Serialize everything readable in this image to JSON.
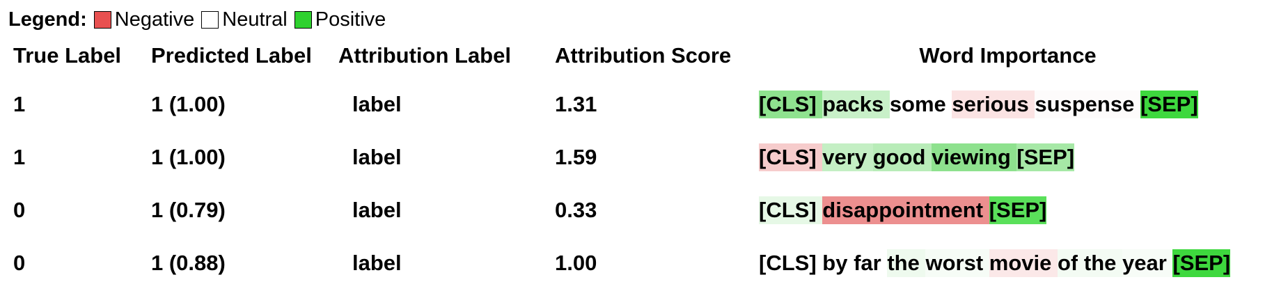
{
  "legend": {
    "title": "Legend:",
    "items": [
      {
        "label": "Negative",
        "color": "#e85050"
      },
      {
        "label": "Neutral",
        "color": "#ffffff"
      },
      {
        "label": "Positive",
        "color": "#2fd12f"
      }
    ]
  },
  "table": {
    "headers": [
      "True Label",
      "Predicted Label",
      "Attribution Label",
      "Attribution Score",
      "Word Importance"
    ],
    "rows": [
      {
        "true_label": "1",
        "predicted_label": "1 (1.00)",
        "attribution_label": "label",
        "attribution_score": "1.31",
        "tokens": [
          {
            "text": "[CLS]",
            "color": "#8fe28f"
          },
          {
            "text": "packs",
            "color": "#c8f0c8"
          },
          {
            "text": "some",
            "color": "#ffffff"
          },
          {
            "text": "serious",
            "color": "#fbe3e3"
          },
          {
            "text": "suspense",
            "color": "#fdfbfb"
          },
          {
            "text": "[SEP]",
            "color": "#3ed83e"
          }
        ]
      },
      {
        "true_label": "1",
        "predicted_label": "1 (1.00)",
        "attribution_label": "label",
        "attribution_score": "1.59",
        "tokens": [
          {
            "text": "[CLS]",
            "color": "#f6cccc"
          },
          {
            "text": "very",
            "color": "#c4efc4"
          },
          {
            "text": "good",
            "color": "#b8ecb8"
          },
          {
            "text": "viewing",
            "color": "#8ee18e"
          },
          {
            "text": "[SEP]",
            "color": "#a6e8a6"
          }
        ]
      },
      {
        "true_label": "0",
        "predicted_label": "1 (0.79)",
        "attribution_label": "label",
        "attribution_score": "0.33",
        "tokens": [
          {
            "text": "[CLS]",
            "color": "#e6f8e6"
          },
          {
            "text": "disappointment",
            "color": "#ec8f8f"
          },
          {
            "text": "[SEP]",
            "color": "#5ae05a"
          }
        ]
      },
      {
        "true_label": "0",
        "predicted_label": "1 (0.88)",
        "attribution_label": "label",
        "attribution_score": "1.00",
        "tokens": [
          {
            "text": "[CLS]",
            "color": "#ffffff"
          },
          {
            "text": "by",
            "color": "#ffffff"
          },
          {
            "text": "far",
            "color": "#ffffff"
          },
          {
            "text": "the",
            "color": "#eefaee"
          },
          {
            "text": "worst",
            "color": "#f6fcf6"
          },
          {
            "text": "movie",
            "color": "#fbe8e8"
          },
          {
            "text": "of",
            "color": "#f3fbf3"
          },
          {
            "text": "the",
            "color": "#f3fbf3"
          },
          {
            "text": "year",
            "color": "#f7fcf7"
          },
          {
            "text": "[SEP]",
            "color": "#3ed83e"
          }
        ]
      }
    ]
  }
}
